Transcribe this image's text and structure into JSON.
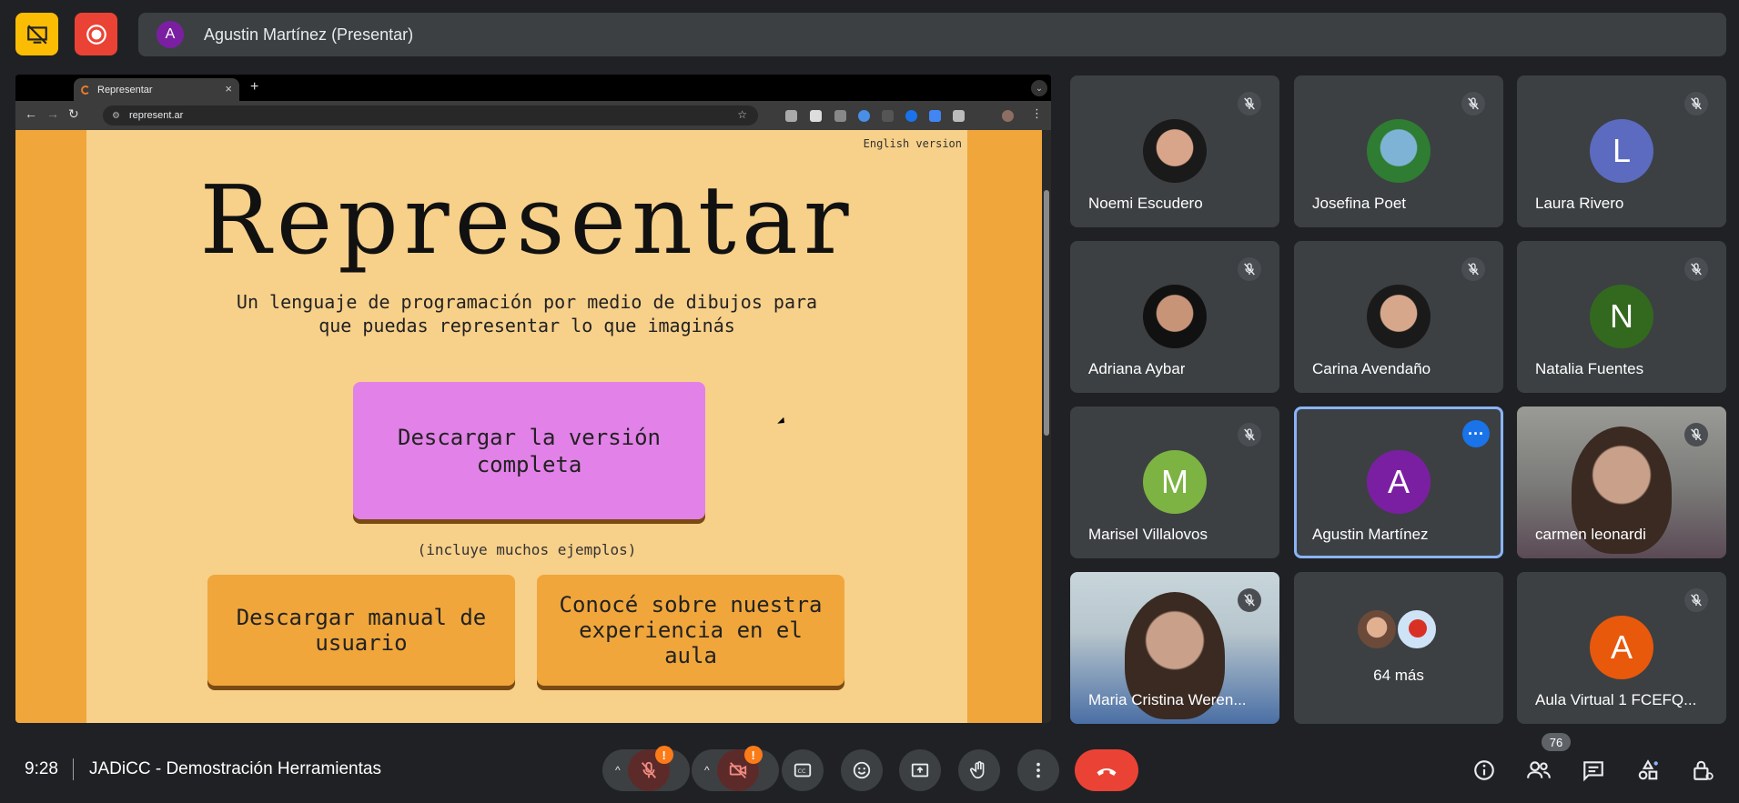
{
  "presenter_bar": {
    "avatar_letter": "A",
    "label": "Agustin Martínez (Presentar)"
  },
  "browser": {
    "tab_title": "Representar",
    "url": "represent.ar"
  },
  "site": {
    "english_link": "English version",
    "logo": "Representar",
    "subtitle_line1": "Un lenguaje de programación por medio de dibujos para",
    "subtitle_line2": "que puedas representar lo que imaginás",
    "download_full": "Descargar la versión completa",
    "download_note": "(incluye muchos ejemplos)",
    "download_manual": "Descargar manual de usuario",
    "experience": "Conocé sobre nuestra experiencia en el aula"
  },
  "participants": [
    {
      "name": "Noemi Escudero",
      "type": "photo"
    },
    {
      "name": "Josefina Poet",
      "type": "photo"
    },
    {
      "name": "Laura Rivero",
      "type": "letter",
      "letter": "L",
      "color": "#5c6bc0"
    },
    {
      "name": "Adriana Aybar",
      "type": "photo"
    },
    {
      "name": "Carina Avendaño",
      "type": "photo"
    },
    {
      "name": "Natalia Fuentes",
      "type": "letter",
      "letter": "N",
      "color": "#33691e"
    },
    {
      "name": "Marisel Villalovos",
      "type": "letter",
      "letter": "M",
      "color": "#7cb342"
    },
    {
      "name": "Agustin Martínez",
      "type": "letter",
      "letter": "A",
      "color": "#7b1fa2"
    },
    {
      "name": "carmen leonardi",
      "type": "video"
    },
    {
      "name": "Maria Cristina Weren...",
      "type": "video"
    },
    {
      "name": "64 más",
      "type": "more"
    },
    {
      "name": "Aula Virtual 1 FCEFQ...",
      "type": "letter",
      "letter": "A",
      "color": "#e8590c"
    }
  ],
  "bottom": {
    "time": "9:28",
    "meeting_name": "JADiCC - Demostración Herramientas",
    "mic_badge": "!",
    "cam_badge": "!",
    "people_count": "76"
  }
}
